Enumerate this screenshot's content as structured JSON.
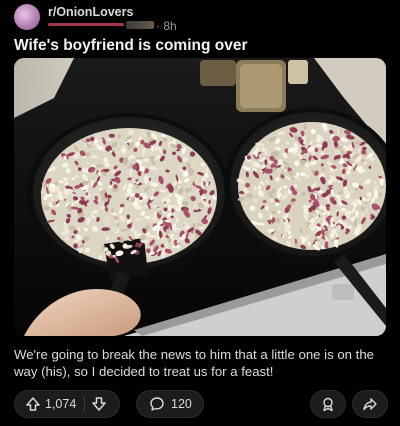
{
  "header": {
    "subreddit": "r/OnionLovers",
    "timestamp": "8h"
  },
  "post": {
    "title": "Wife's boyfriend is coming over",
    "body": "We're going to break the news to him that a little one is on the way (his), so I decided to treat us for a feast!"
  },
  "actions": {
    "upvotes": "1,074",
    "comments": "120"
  },
  "icons": [
    "avatar",
    "upvote-icon",
    "downvote-icon",
    "comment-icon",
    "award-icon",
    "share-icon"
  ],
  "colors": {
    "background": "#000000",
    "pill": "#1c1c1c",
    "text": "#e8e8e8"
  }
}
